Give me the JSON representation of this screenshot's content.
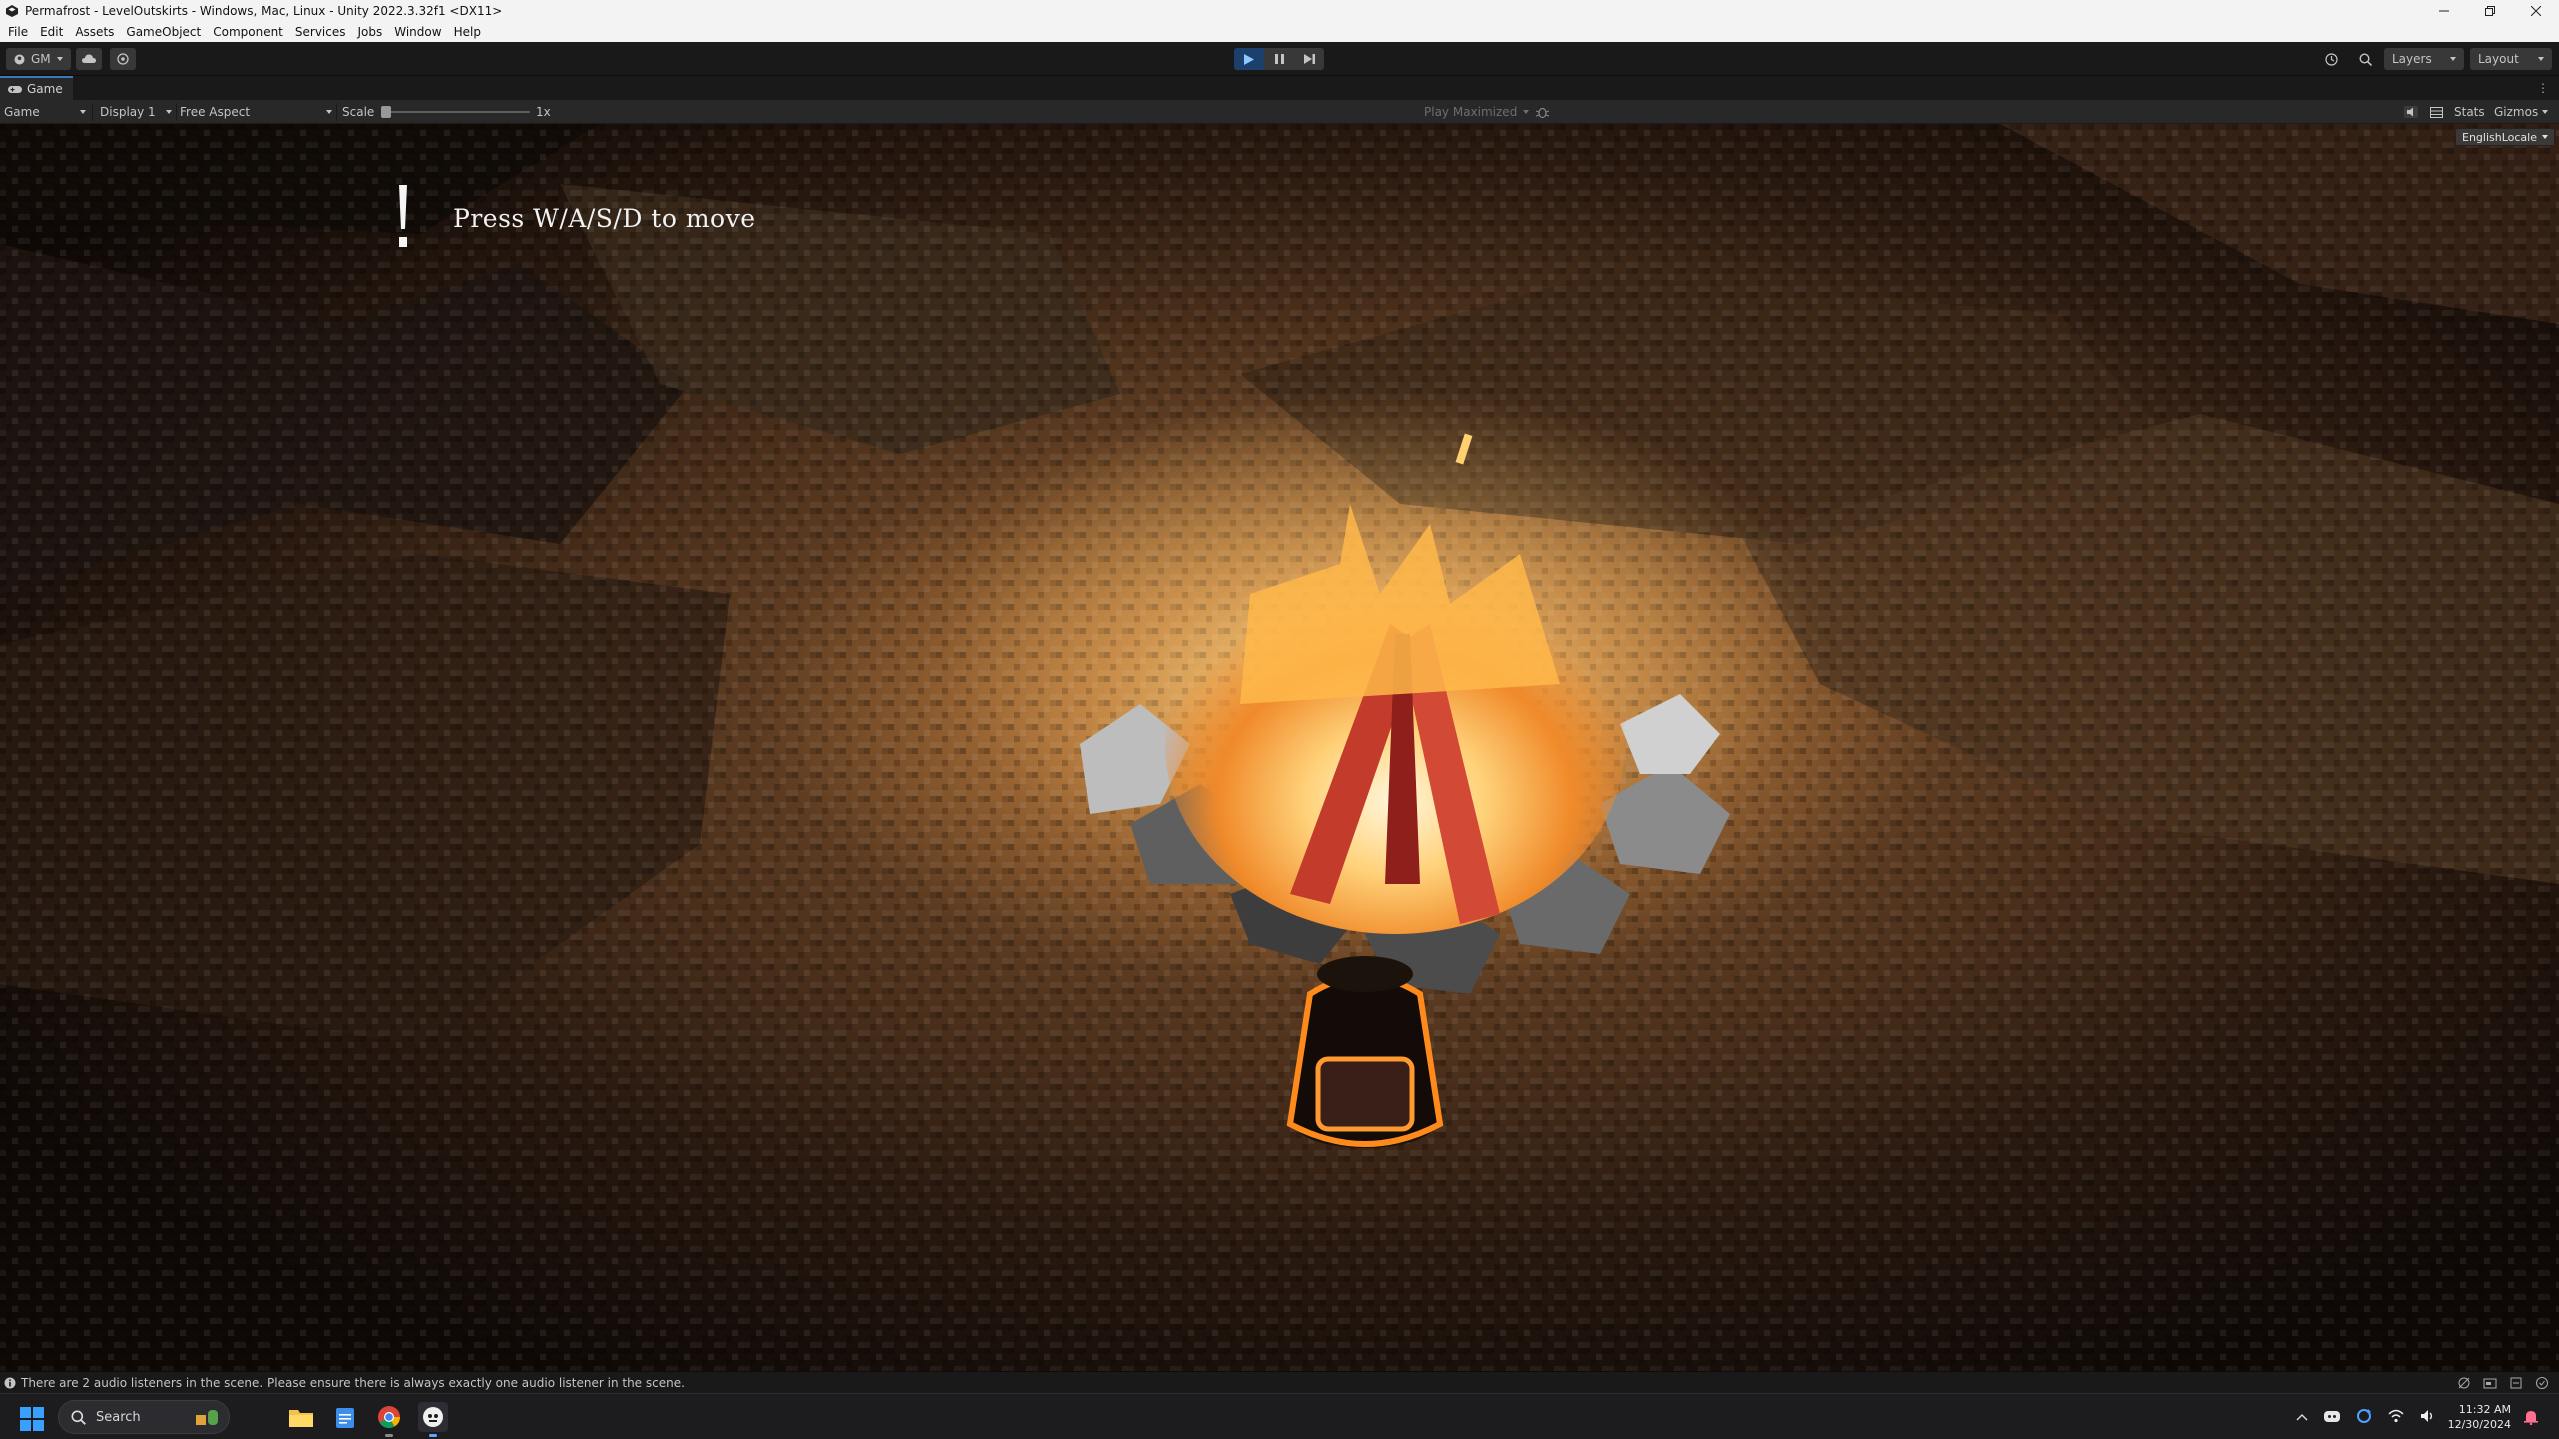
{
  "window": {
    "title": "Permafrost - LevelOutskirts - Windows, Mac, Linux - Unity 2022.3.32f1 <DX11>",
    "controls": [
      "minimize-icon",
      "restore-icon",
      "close-icon"
    ]
  },
  "menu": [
    "File",
    "Edit",
    "Assets",
    "GameObject",
    "Component",
    "Services",
    "Jobs",
    "Window",
    "Help"
  ],
  "toolbar": {
    "account_label": "GM",
    "layers_label": "Layers",
    "layout_label": "Layout",
    "play_state": "playing"
  },
  "game_tab": {
    "tab_label": "Game",
    "mode_label": "Game",
    "display_label": "Display 1",
    "aspect_label": "Free Aspect",
    "scale_label": "Scale",
    "scale_value": "1x",
    "play_maximized_label": "Play Maximized",
    "stats_label": "Stats",
    "gizmos_label": "Gizmos"
  },
  "game_view": {
    "locale_label": "EnglishLocale",
    "hint_text": "Press W/A/S/D to move"
  },
  "console": {
    "message": "There are 2 audio listeners in the scene. Please ensure there is always exactly one audio listener in the scene."
  },
  "taskbar": {
    "search_placeholder": "Search",
    "apps": [
      "file-explorer-icon",
      "notepad-icon",
      "chrome-icon",
      "unity-icon"
    ],
    "time": "11:32 AM",
    "date": "12/30/2024"
  },
  "colors": {
    "editor_bg": "#191919",
    "panel_bg": "#282828",
    "play_active": "#1c3f6b",
    "accent": "#3a79bb",
    "fire": "#ffb84a"
  }
}
